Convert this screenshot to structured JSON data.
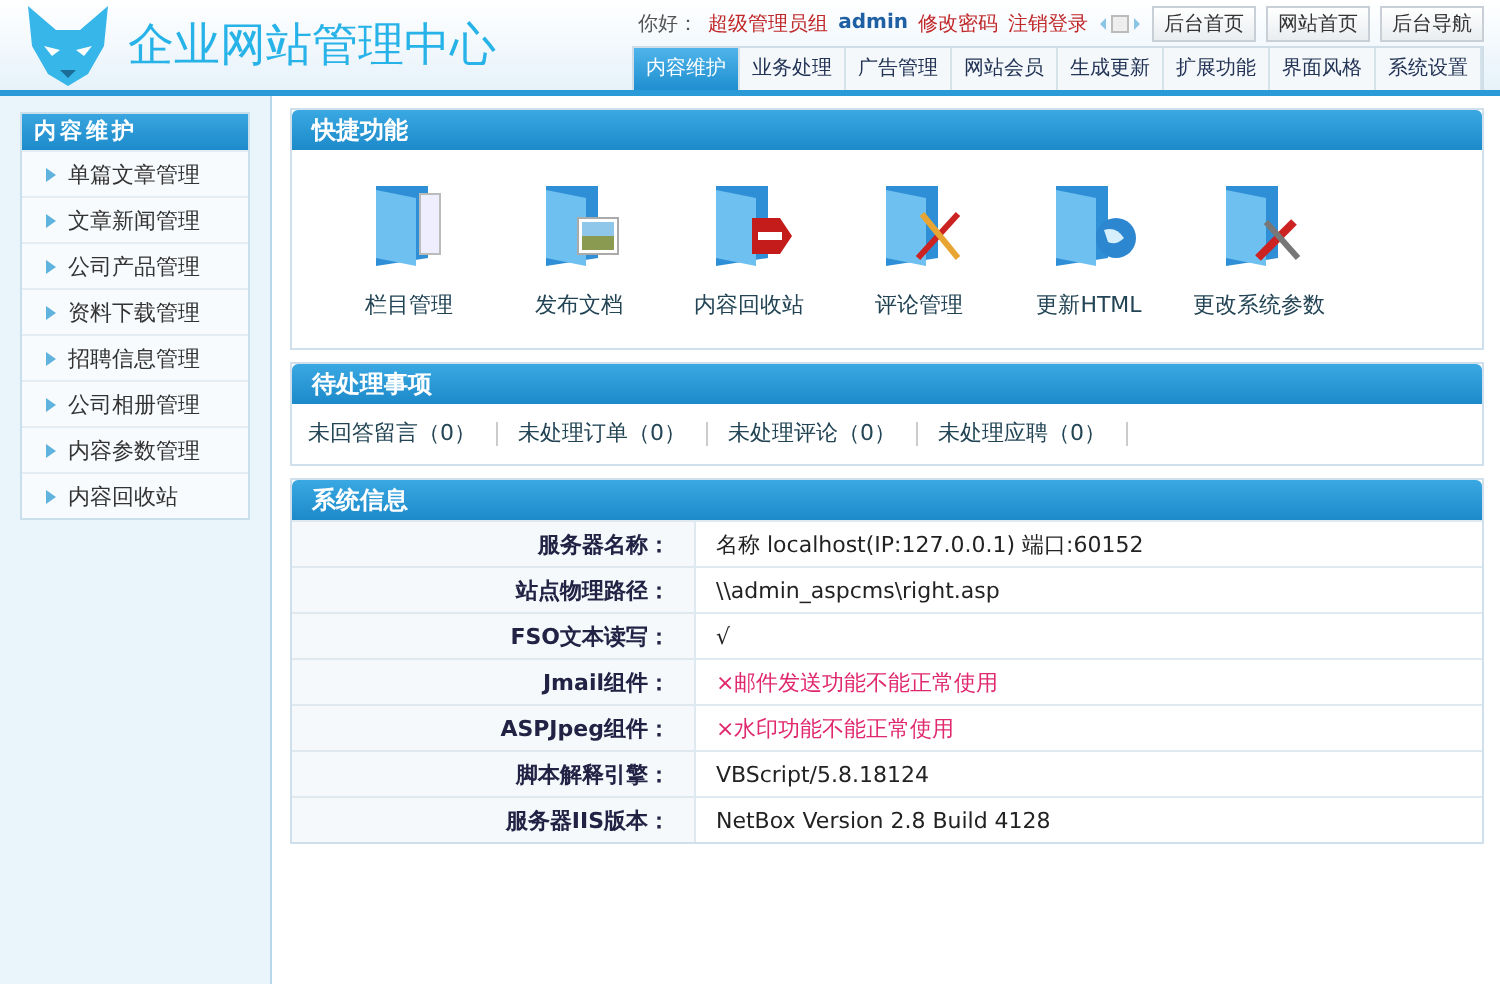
{
  "header": {
    "title": "企业网站管理中心",
    "greeting": "你好：",
    "role": "超级管理员组",
    "user": "admin",
    "links": [
      "修改密码",
      "注销登录"
    ],
    "buttons": [
      "后台首页",
      "网站首页",
      "后台导航"
    ]
  },
  "tabs": [
    {
      "label": "内容维护",
      "selected": true
    },
    {
      "label": "业务处理",
      "selected": false
    },
    {
      "label": "广告管理",
      "selected": false
    },
    {
      "label": "网站会员",
      "selected": false
    },
    {
      "label": "生成更新",
      "selected": false
    },
    {
      "label": "扩展功能",
      "selected": false
    },
    {
      "label": "界面风格",
      "selected": false
    },
    {
      "label": "系统设置",
      "selected": false
    }
  ],
  "sidebar": {
    "title": "内容维护",
    "items": [
      "单篇文章管理",
      "文章新闻管理",
      "公司产品管理",
      "资料下载管理",
      "招聘信息管理",
      "公司相册管理",
      "内容参数管理",
      "内容回收站"
    ]
  },
  "shortcuts": {
    "title": "快捷功能",
    "items": [
      {
        "label": "栏目管理",
        "kind": "pages"
      },
      {
        "label": "发布文档",
        "kind": "photo"
      },
      {
        "label": "内容回收站",
        "kind": "stop"
      },
      {
        "label": "评论管理",
        "kind": "pen"
      },
      {
        "label": "更新HTML",
        "kind": "globe"
      },
      {
        "label": "更改系统参数",
        "kind": "tools"
      }
    ]
  },
  "pending": {
    "title": "待处理事项",
    "items": [
      {
        "label": "未回答留言",
        "count": "（0）"
      },
      {
        "label": "未处理订单",
        "count": "（0）"
      },
      {
        "label": "未处理评论",
        "count": "（0）"
      },
      {
        "label": "未处理应聘",
        "count": "（0）"
      }
    ]
  },
  "system_info": {
    "title": "系统信息",
    "rows": [
      {
        "label": "服务器名称：",
        "value": "名称 localhost(IP:127.0.0.1) 端口:60152",
        "warn": false
      },
      {
        "label": "站点物理路径：",
        "value": "\\\\admin_aspcms\\right.asp",
        "warn": false
      },
      {
        "label": "FSO文本读写：",
        "value": "√",
        "warn": false
      },
      {
        "label": "Jmail组件：",
        "value": "×邮件发送功能不能正常使用",
        "warn": true
      },
      {
        "label": "ASPJpeg组件：",
        "value": "×水印功能不能正常使用",
        "warn": true
      },
      {
        "label": "脚本解释引擎：",
        "value": "VBScript/5.8.18124",
        "warn": false
      },
      {
        "label": "服务器IIS版本：",
        "value": "NetBox Version 2.8 Build 4128",
        "warn": false
      }
    ]
  }
}
